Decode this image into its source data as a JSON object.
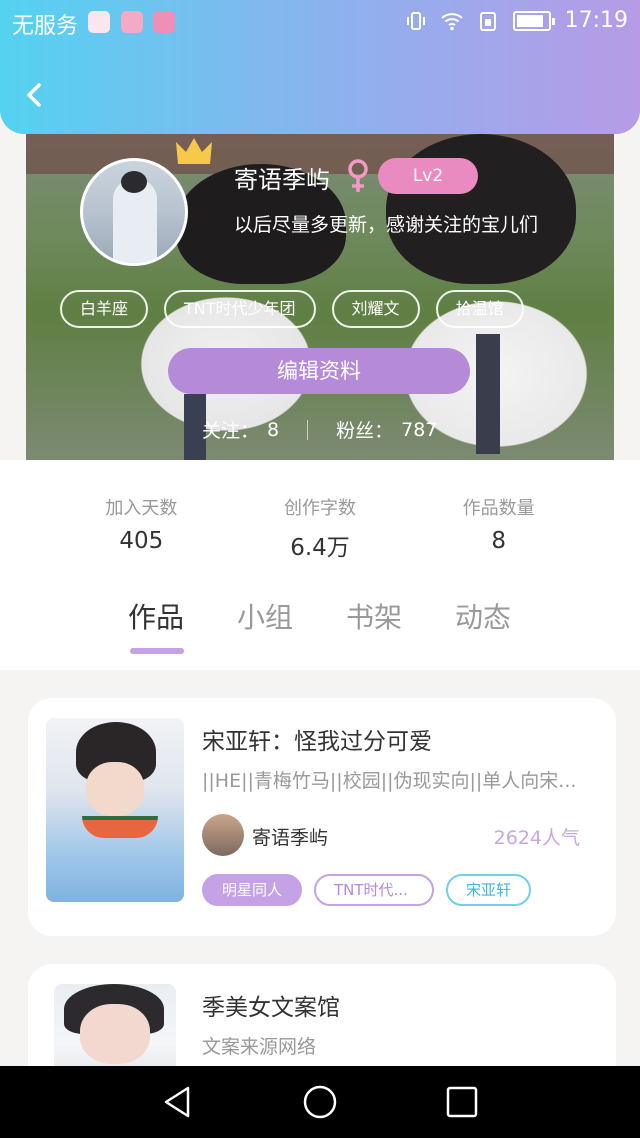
{
  "status_bar": {
    "carrier": "无服务",
    "time": "17:19"
  },
  "profile": {
    "username": "寄语季屿",
    "level": "Lv2",
    "bio": "以后尽量多更新，感谢关注的宝儿们",
    "tags": [
      "白羊座",
      "TNT时代少年团",
      "刘耀文",
      "拾温馆"
    ],
    "edit_button": "编辑资料",
    "following_label": "关注：",
    "following_value": "8",
    "fans_label": "粉丝：",
    "fans_value": "787"
  },
  "stats": [
    {
      "label": "加入天数",
      "value": "405"
    },
    {
      "label": "创作字数",
      "value": "6.4万"
    },
    {
      "label": "作品数量",
      "value": "8"
    }
  ],
  "tabs": [
    "作品",
    "小组",
    "书架",
    "动态"
  ],
  "works": [
    {
      "title": "宋亚轩：怪我过分可爱",
      "description": "||HE||青梅竹马||校园||伪现实向||单人向宋...",
      "author": "寄语季屿",
      "popularity": "2624人气",
      "tags": [
        "明星同人",
        "TNT时代...",
        "宋亚轩"
      ]
    },
    {
      "title": "季美女文案馆",
      "description": "文案来源网络"
    }
  ],
  "colors": {
    "header_gradient_start": "#54d2f0",
    "header_gradient_end": "#b79be6",
    "accent_purple": "#b48ad9",
    "level_pink": "#e98bc0"
  }
}
